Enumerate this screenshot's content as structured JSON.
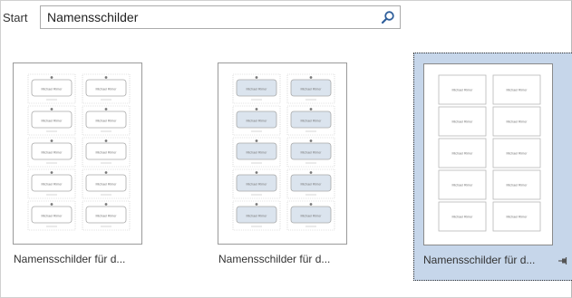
{
  "header": {
    "start_label": "Start",
    "search": {
      "value": "Namensschilder",
      "icon": "search-icon"
    }
  },
  "templates": [
    {
      "caption": "Namensschilder für d...",
      "style": "ornate-border",
      "card_name": "Michael Rimer",
      "selected": false
    },
    {
      "caption": "Namensschilder für d...",
      "style": "blue-ornate",
      "card_name": "Michael Rimer",
      "selected": false
    },
    {
      "caption": "Namensschilder für d...",
      "style": "plain",
      "card_name": "Michael Rimer",
      "selected": true,
      "pin_icon": "pin-icon"
    }
  ],
  "colors": {
    "selection_fill": "#c6d6ea",
    "search_icon": "#2f5f9b",
    "blue_card_fill": "#dbe4ee"
  }
}
